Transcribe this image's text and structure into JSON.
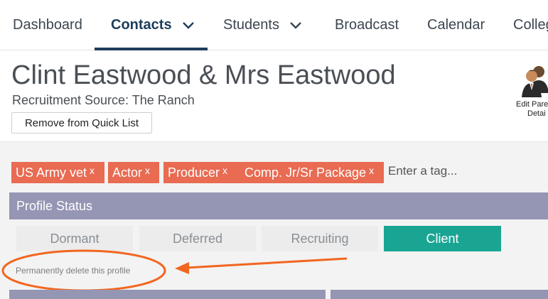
{
  "nav": {
    "items": [
      {
        "label": "Dashboard"
      },
      {
        "label": "Contacts"
      },
      {
        "label": "Students"
      },
      {
        "label": "Broadcast"
      },
      {
        "label": "Calendar"
      },
      {
        "label": "Colleg"
      }
    ],
    "active": "Contacts"
  },
  "profile": {
    "name": "Clint Eastwood & Mrs Eastwood",
    "recruitment_source": "Recruitment Source: The Ranch",
    "quick_list_button": "Remove from Quick List",
    "edit_parent_label_line1": "Edit Pare",
    "edit_parent_label_line2": "Detai"
  },
  "tags": {
    "items": [
      {
        "label": "US Army vet",
        "remove": "x"
      },
      {
        "label": "Actor",
        "remove": "x"
      },
      {
        "label": "Producer",
        "remove": "x"
      },
      {
        "label": "Comp. Jr/Sr Package",
        "remove": "x"
      }
    ],
    "input_placeholder": "Enter a tag..."
  },
  "profile_status": {
    "title": "Profile Status",
    "options": [
      {
        "label": "Dormant"
      },
      {
        "label": "Deferred"
      },
      {
        "label": "Recruiting"
      },
      {
        "label": "Client"
      }
    ],
    "selected": "Client",
    "delete_link": "Permanently delete this profile"
  },
  "colors": {
    "nav_active": "#1d3d5c",
    "tag_bg": "#e86b52",
    "status_header_bg": "#9595b4",
    "status_selected_bg": "#1aa593",
    "annotation": "#f2661f"
  },
  "icons": {
    "chevron": "chevron-down-icon",
    "edit_parent": "parents-people-icon"
  }
}
